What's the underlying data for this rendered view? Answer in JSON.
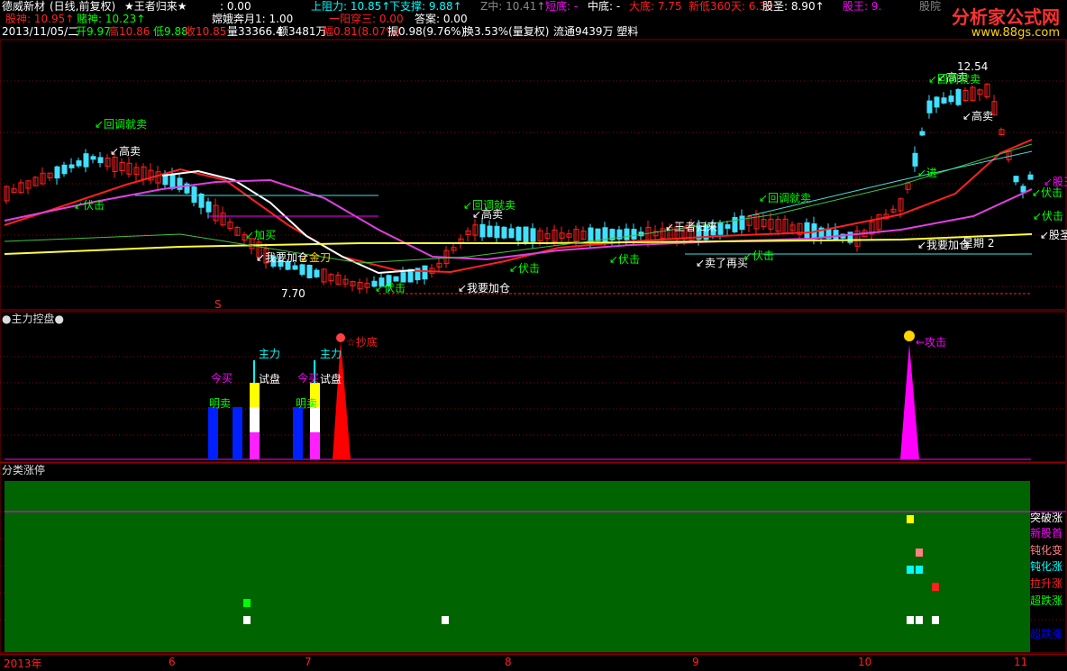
{
  "header": {
    "row1": [
      {
        "text": "德威新材",
        "color": "#ffffff"
      },
      {
        "text": "(日线,前复权)",
        "color": "#ffffff"
      },
      {
        "text": "★王者归来★",
        "color": "#ffffff"
      },
      {
        "text": ": 0.00",
        "color": "#ffffff"
      },
      {
        "text": "上阻力: 10.85↑",
        "color": "#00ffff"
      },
      {
        "text": "下支撑: 9.88↑",
        "color": "#00ffff"
      },
      {
        "text": "Z中: 10.41↑",
        "color": "#888888"
      },
      {
        "text": "短底: -",
        "color": "#ff00ff"
      },
      {
        "text": "中底: -",
        "color": "#ffffff"
      },
      {
        "text": "大底: 7.75",
        "color": "#ff2020"
      },
      {
        "text": "新低360天: 6.33",
        "color": "#ff2020"
      },
      {
        "text": "股圣: 8.90↑",
        "color": "#ffffff"
      },
      {
        "text": "股王: 9.",
        "color": "#ff00ff"
      },
      {
        "text": "股院",
        "color": "#888888"
      }
    ],
    "row2": [
      {
        "text": "股神: 10.95↑",
        "color": "#ff2020"
      },
      {
        "text": "赌神: 10.23↑",
        "color": "#00ff00"
      },
      {
        "text": "嫦娥奔月1: 1.00",
        "color": "#ffffff"
      },
      {
        "text": "一阳穿三: 0.00",
        "color": "#ff2020"
      },
      {
        "text": "答案: 0.00",
        "color": "#ffffff"
      }
    ],
    "row3": [
      {
        "text": "2013/11/05/二",
        "color": "#ffffff"
      },
      {
        "text": "开9.97",
        "color": "#00ff00"
      },
      {
        "text": "高10.86",
        "color": "#ff2020"
      },
      {
        "text": "低9.88",
        "color": "#00ff00"
      },
      {
        "text": "收10.85",
        "color": "#ff2020"
      },
      {
        "text": "量33366.4",
        "color": "#ffffff"
      },
      {
        "text": "额3481万",
        "color": "#ffffff"
      },
      {
        "text": "幅0.81(8.07%)",
        "color": "#ff2020"
      },
      {
        "text": "振0.98(9.76%)",
        "color": "#ffffff"
      },
      {
        "text": "换3.53%(量复权)",
        "color": "#ffffff"
      },
      {
        "text": "流通9439万 塑料",
        "color": "#ffffff"
      }
    ]
  },
  "watermark": {
    "title": "分析家公式网",
    "url": "www.88gs.com"
  },
  "main_chart": {
    "annotations": [
      {
        "text": "12.54",
        "color": "#ffffff"
      },
      {
        "text": "回调就卖",
        "color": "#00ff00"
      },
      {
        "text": "高卖",
        "color": "#ffffff"
      },
      {
        "text": "回调就卖",
        "color": "#00ff00"
      },
      {
        "text": "高卖",
        "color": "#ffffff"
      },
      {
        "text": "回调就卖",
        "color": "#00ff00"
      },
      {
        "text": "高卖",
        "color": "#ffffff"
      },
      {
        "text": "高卖",
        "color": "#ffffff"
      },
      {
        "text": "回调就卖",
        "color": "#00ff00"
      },
      {
        "text": "伏击",
        "color": "#00ff00"
      },
      {
        "text": "加买",
        "color": "#00ff00"
      },
      {
        "text": "我要加仓",
        "color": "#ffffff"
      },
      {
        "text": "金刀",
        "color": "#ffd400"
      },
      {
        "text": "7.70",
        "color": "#ffffff"
      },
      {
        "text": "伏击",
        "color": "#00ff00"
      },
      {
        "text": "我要加仓",
        "color": "#ffffff"
      },
      {
        "text": "伏击",
        "color": "#00ff00"
      },
      {
        "text": "伏击",
        "color": "#00ff00"
      },
      {
        "text": "王者归来",
        "color": "#ffffff"
      },
      {
        "text": "卖了再买",
        "color": "#ffffff"
      },
      {
        "text": "伏击",
        "color": "#00ff00"
      },
      {
        "text": "伏击",
        "color": "#00ff00"
      },
      {
        "text": "股王",
        "color": "#ff00ff"
      },
      {
        "text": "伏击",
        "color": "#00ff00"
      },
      {
        "text": "股圣",
        "color": "#ffffff"
      },
      {
        "text": "我要加仓",
        "color": "#ffffff"
      },
      {
        "text": "星期 2",
        "color": "#ffffff"
      },
      {
        "text": "进",
        "color": "#00ff00"
      },
      {
        "text": "S",
        "color": "#ff2020"
      }
    ]
  },
  "panel2": {
    "title": "●主力控盘●",
    "labels": [
      {
        "text": "今买",
        "color": "#ff00ff"
      },
      {
        "text": "明卖",
        "color": "#00ff00"
      },
      {
        "text": "主力",
        "color": "#00ffff"
      },
      {
        "text": "试盘",
        "color": "#ffffff"
      },
      {
        "text": "今买",
        "color": "#ff00ff"
      },
      {
        "text": "明卖",
        "color": "#00ff00"
      },
      {
        "text": "主力",
        "color": "#00ffff"
      },
      {
        "text": "试盘",
        "color": "#ffffff"
      },
      {
        "text": "抄底",
        "color": "#ff2020"
      },
      {
        "text": "攻击",
        "color": "#ff00ff"
      }
    ]
  },
  "panel3": {
    "title": "分类涨停",
    "legend": [
      {
        "text": "突破涨",
        "color": "#ffffff"
      },
      {
        "text": "新股首",
        "color": "#ff00ff"
      },
      {
        "text": "钝化变",
        "color": "#ff8080"
      },
      {
        "text": "钝化涨",
        "color": "#00ffff"
      },
      {
        "text": "拉升涨",
        "color": "#ff2020"
      },
      {
        "text": "超跌涨",
        "color": "#00ff00"
      },
      {
        "text": "超跌涨",
        "color": "#0000ff"
      }
    ]
  },
  "x_axis": {
    "labels": [
      "2013年",
      "6",
      "7",
      "8",
      "9",
      "10",
      "11"
    ]
  },
  "colors": {
    "up": "#ff2020",
    "down": "#40e0ff",
    "ma_red": "#ff2020",
    "ma_white": "#ffffff",
    "ma_magenta": "#e040e0",
    "ma_yellow": "#ffff40",
    "ma_green": "#40c040",
    "panel3_bg": "#006400",
    "grid": "#8b0000"
  }
}
